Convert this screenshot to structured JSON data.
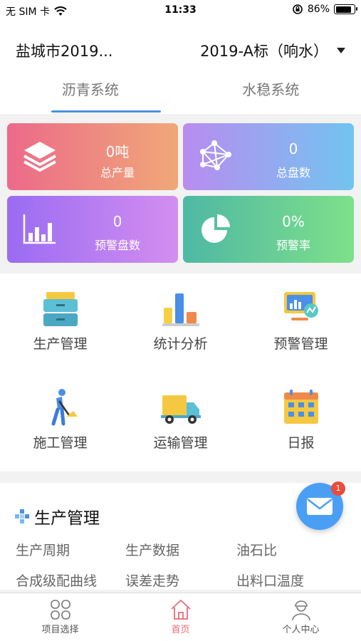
{
  "status_bar": {
    "carrier": "无 SIM 卡",
    "time": "11:33",
    "battery_text": "86%",
    "battery_level": 0.86
  },
  "header": {
    "city": "盐城市2019...",
    "bid": "2019-A标（响水）"
  },
  "tabs": [
    {
      "label": "沥青系统",
      "active": true
    },
    {
      "label": "水稳系统",
      "active": false
    }
  ],
  "stats": [
    {
      "value": "0吨",
      "label": "总产量",
      "gradient": [
        "#ec6a8a",
        "#f0a878"
      ],
      "icon": "layers-icon"
    },
    {
      "value": "0",
      "label": "总盘数",
      "gradient": [
        "#b98cf0",
        "#72c4f0"
      ],
      "icon": "network-icon"
    },
    {
      "value": "0",
      "label": "预警盘数",
      "gradient": [
        "#9a6cf2",
        "#d48ef0"
      ],
      "icon": "bar-chart-icon"
    },
    {
      "value": "0%",
      "label": "预警率",
      "gradient": [
        "#4fb8a4",
        "#7ee08a"
      ],
      "icon": "pie-chart-icon"
    }
  ],
  "menu": [
    {
      "label": "生产管理",
      "icon": "cabinet-icon"
    },
    {
      "label": "统计分析",
      "icon": "statistics-icon"
    },
    {
      "label": "预警管理",
      "icon": "monitor-icon"
    },
    {
      "label": "施工管理",
      "icon": "worker-icon"
    },
    {
      "label": "运输管理",
      "icon": "truck-icon"
    },
    {
      "label": "日报",
      "icon": "calendar-icon"
    }
  ],
  "section": {
    "title": "生产管理",
    "items": [
      "生产周期",
      "生产数据",
      "油石比",
      "合成级配曲线",
      "误差走势",
      "出料口温度"
    ]
  },
  "fab": {
    "badge": "1"
  },
  "tabbar": [
    {
      "label": "项目选择",
      "icon": "grid-icon",
      "active": false
    },
    {
      "label": "首页",
      "icon": "home-icon",
      "active": true
    },
    {
      "label": "个人中心",
      "icon": "user-icon",
      "active": false
    }
  ],
  "colors": {
    "accent": "#4a90e2",
    "active_tab_text": "#e86a7a",
    "fab": "#4a9ff5",
    "badge": "#e74c3c"
  }
}
